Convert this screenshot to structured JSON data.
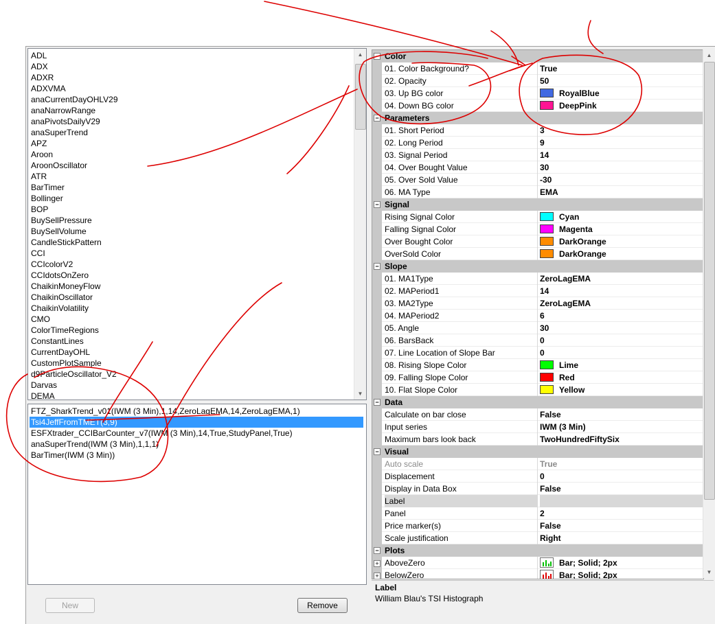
{
  "indicator_list": {
    "items": [
      "ADL",
      "ADX",
      "ADXR",
      "ADXVMA",
      "anaCurrentDayOHLV29",
      "anaNarrowRange",
      "anaPivotsDailyV29",
      "anaSuperTrend",
      "APZ",
      "Aroon",
      "AroonOscillator",
      "ATR",
      "BarTimer",
      "Bollinger",
      "BOP",
      "BuySellPressure",
      "BuySellVolume",
      "CandleStickPattern",
      "CCI",
      "CCIcolorV2",
      "CCIdotsOnZero",
      "ChaikinMoneyFlow",
      "ChaikinOscillator",
      "ChaikinVolatility",
      "CMO",
      "ColorTimeRegions",
      "ConstantLines",
      "CurrentDayOHL",
      "CustomPlotSample",
      "d9ParticleOscillator_V2",
      "Darvas",
      "DEMA"
    ]
  },
  "applied_list": {
    "items": [
      "FTZ_SharkTrend_v01(IWM (3 Min),1,14,ZeroLagEMA,14,ZeroLagEMA,1)",
      "Tsi4JeffFromTMET(3,9)",
      "ESFXtrader_CCIBarCounter_v7(IWM (3 Min),14,True,StudyPanel,True)",
      "anaSuperTrend(IWM (3 Min),1,1,1)",
      "BarTimer(IWM (3 Min))"
    ],
    "selected_index": 1
  },
  "buttons": {
    "new": "New",
    "remove": "Remove"
  },
  "grid": {
    "collapse_glyph": "−",
    "expand_glyph": "+",
    "categories": [
      {
        "name": "Color",
        "rows": [
          {
            "name": "01. Color Background?",
            "value": "True"
          },
          {
            "name": "02. Opacity",
            "value": "50"
          },
          {
            "name": "03. Up BG color",
            "value": "RoyalBlue",
            "color": "#4169e1"
          },
          {
            "name": "04. Down BG color",
            "value": "DeepPink",
            "color": "#ff1493"
          }
        ]
      },
      {
        "name": "Parameters",
        "rows": [
          {
            "name": "01. Short Period",
            "value": "3"
          },
          {
            "name": "02. Long Period",
            "value": "9"
          },
          {
            "name": "03. Signal Period",
            "value": "14"
          },
          {
            "name": "04. Over Bought Value",
            "value": "30"
          },
          {
            "name": "05. Over Sold Value",
            "value": "-30"
          },
          {
            "name": "06. MA Type",
            "value": "EMA"
          }
        ]
      },
      {
        "name": "Signal",
        "rows": [
          {
            "name": " Rising Signal Color",
            "value": "Cyan",
            "color": "#00ffff"
          },
          {
            "name": "Falling Signal Color",
            "value": "Magenta",
            "color": "#ff00ff"
          },
          {
            "name": "Over Bought Color",
            "value": "DarkOrange",
            "color": "#ff8c00"
          },
          {
            "name": "OverSold Color",
            "value": "DarkOrange",
            "color": "#ff8c00"
          }
        ]
      },
      {
        "name": "Slope",
        "rows": [
          {
            "name": "01. MA1Type",
            "value": "ZeroLagEMA"
          },
          {
            "name": "02. MAPeriod1",
            "value": "14"
          },
          {
            "name": "03. MA2Type",
            "value": "ZeroLagEMA"
          },
          {
            "name": "04. MAPeriod2",
            "value": "6"
          },
          {
            "name": "05. Angle",
            "value": "30"
          },
          {
            "name": "06. BarsBack",
            "value": "0"
          },
          {
            "name": "07. Line Location of Slope Bar",
            "value": "0"
          },
          {
            "name": "08. Rising Slope Color",
            "value": "Lime",
            "color": "#00ff00"
          },
          {
            "name": "09. Falling Slope Color",
            "value": "Red",
            "color": "#ff0000"
          },
          {
            "name": "10. Flat Slope Color",
            "value": "Yellow",
            "color": "#ffff00"
          }
        ]
      },
      {
        "name": "Data",
        "rows": [
          {
            "name": "Calculate on bar close",
            "value": "False"
          },
          {
            "name": "Input series",
            "value": "IWM (3 Min)"
          },
          {
            "name": "Maximum bars look back",
            "value": "TwoHundredFiftySix"
          }
        ]
      },
      {
        "name": "Visual",
        "rows": [
          {
            "name": "Auto scale",
            "value": "True",
            "disabled": true
          },
          {
            "name": "Displacement",
            "value": "0"
          },
          {
            "name": "Display in Data Box",
            "value": "False"
          },
          {
            "name": "Label",
            "value": "",
            "shaded": true
          },
          {
            "name": "Panel",
            "value": "2"
          },
          {
            "name": "Price marker(s)",
            "value": "False"
          },
          {
            "name": "Scale justification",
            "value": "Right"
          }
        ]
      },
      {
        "name": "Plots",
        "rows": [
          {
            "name": "AboveZero",
            "value": "Bar; Solid; 2px",
            "plot": true,
            "color": "#00c000"
          },
          {
            "name": "BelowZero",
            "value": "Bar; Solid; 2px",
            "plot": true,
            "color": "#e00000"
          }
        ]
      }
    ]
  },
  "description": {
    "title": "Label",
    "text": "William Blau's TSI Histograph"
  },
  "annotation_color": "#dd0000"
}
